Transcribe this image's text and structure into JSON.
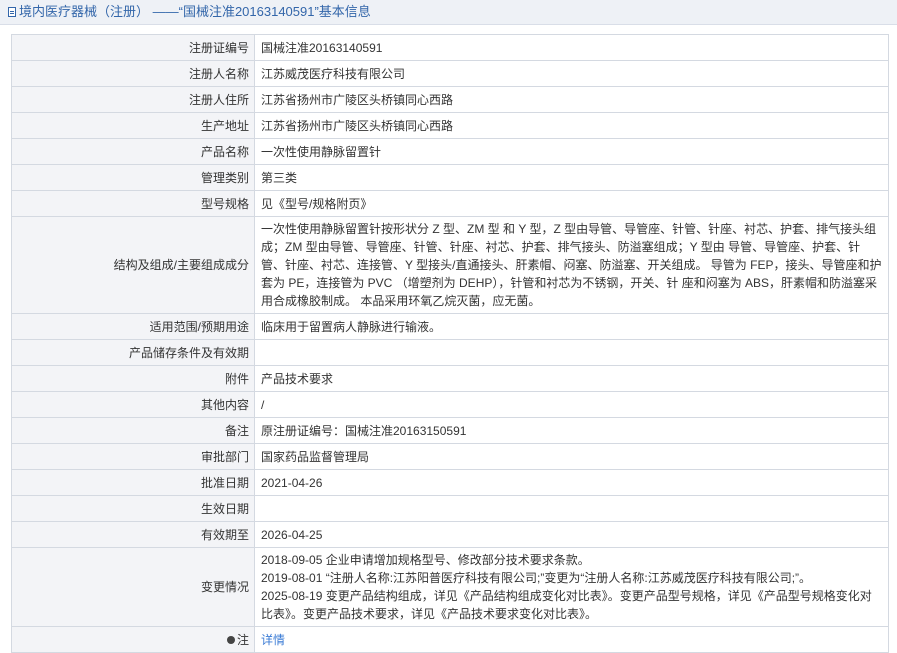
{
  "header": {
    "title": "境内医疗器械（注册） ——“国械注准20163140591”基本信息"
  },
  "rows": [
    {
      "label": "注册证编号",
      "value": "国械注准20163140591"
    },
    {
      "label": "注册人名称",
      "value": "江苏威茂医疗科技有限公司"
    },
    {
      "label": "注册人住所",
      "value": "江苏省扬州市广陵区头桥镇同心西路"
    },
    {
      "label": "生产地址",
      "value": "江苏省扬州市广陵区头桥镇同心西路"
    },
    {
      "label": "产品名称",
      "value": "一次性使用静脉留置针"
    },
    {
      "label": "管理类别",
      "value": "第三类"
    },
    {
      "label": "型号规格",
      "value": "见《型号/规格附页》"
    },
    {
      "label": "结构及组成/主要组成成分",
      "value": "一次性使用静脉留置针按形状分 Z 型、ZM 型 和 Y 型，Z 型由导管、导管座、针管、针座、衬芯、护套、排气接头组成；ZM 型由导管、导管座、针管、针座、衬芯、护套、排气接头、防溢塞组成；Y 型由 导管、导管座、护套、针管、针座、衬芯、连接管、Y 型接头/直通接头、肝素帽、闷塞、防溢塞、开关组成。 导管为 FEP，接头、导管座和护套为 PE，连接管为 PVC （增塑剂为 DEHP），针管和衬芯为不锈钢，开关、针 座和闷塞为 ABS，肝素帽和防溢塞采用合成橡胶制成。 本品采用环氧乙烷灭菌，应无菌。"
    },
    {
      "label": "适用范围/预期用途",
      "value": "临床用于留置病人静脉进行输液。"
    },
    {
      "label": "产品储存条件及有效期",
      "value": ""
    },
    {
      "label": "附件",
      "value": "产品技术要求"
    },
    {
      "label": "其他内容",
      "value": "/"
    },
    {
      "label": "备注",
      "value": "原注册证编号：国械注准20163150591"
    },
    {
      "label": "审批部门",
      "value": "国家药品监督管理局"
    },
    {
      "label": "批准日期",
      "value": "2021-04-26"
    },
    {
      "label": "生效日期",
      "value": ""
    },
    {
      "label": "有效期至",
      "value": "2026-04-25"
    }
  ],
  "changes": {
    "label": "变更情况",
    "lines": [
      "2018-09-05 企业申请增加规格型号、修改部分技术要求条款。",
      "2019-08-01 “注册人名称:江苏阳普医疗科技有限公司;”变更为“注册人名称:江苏威茂医疗科技有限公司;”。",
      "2025-08-19 变更产品结构组成，详见《产品结构组成变化对比表》。变更产品型号规格，详见《产品型号规格变化对比表》。变更产品技术要求，详见《产品技术要求变化对比表》。"
    ]
  },
  "note": {
    "label": "注",
    "icon": "note-icon",
    "link_text": "详情"
  }
}
